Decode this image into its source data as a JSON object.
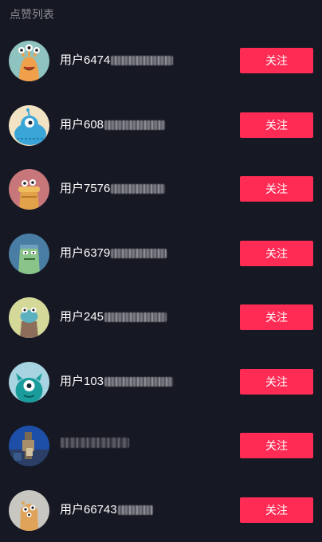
{
  "header": {
    "title": "点赞列表"
  },
  "colors": {
    "background": "#161823",
    "accent": "#fe2c55",
    "muted_text": "#8a8b91"
  },
  "users": [
    {
      "name_visible": "用户6474",
      "follow_label": "关注",
      "avatar_icon": "monster-orange-eyes-icon"
    },
    {
      "name_visible": "用户608",
      "follow_label": "关注",
      "avatar_icon": "monster-blue-icon"
    },
    {
      "name_visible": "用户7576",
      "follow_label": "关注",
      "avatar_icon": "monster-bread-icon"
    },
    {
      "name_visible": "用户6379",
      "follow_label": "关注",
      "avatar_icon": "monster-green-icon"
    },
    {
      "name_visible": "用户245",
      "follow_label": "关注",
      "avatar_icon": "monster-pot-icon"
    },
    {
      "name_visible": "用户103",
      "follow_label": "关注",
      "avatar_icon": "monster-teal-icon"
    },
    {
      "name_visible": "",
      "follow_label": "关注",
      "avatar_icon": "photo-avatar-icon"
    },
    {
      "name_visible": "用户66743",
      "follow_label": "关注",
      "avatar_icon": "monster-tan-icon"
    }
  ]
}
